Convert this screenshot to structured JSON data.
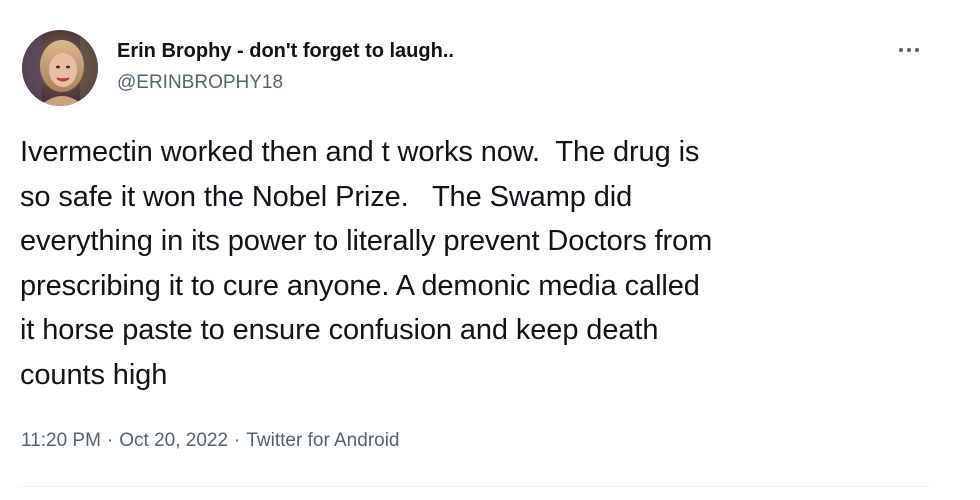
{
  "author": {
    "name": "Erin Brophy - don't forget to laugh..",
    "handle": "@ERINBROPHY18"
  },
  "tweet": {
    "lines": [
      "Ivermectin worked then and t works now.  The drug is",
      "so safe it won the Nobel Prize.   The Swamp did",
      "everything in its power to literally prevent Doctors from",
      "prescribing it to cure anyone. A demonic media called",
      "it horse paste to ensure confusion and keep death",
      "counts high"
    ]
  },
  "meta": {
    "time": "11:20 PM",
    "separator": "·",
    "date": "Oct 20, 2022",
    "source": "Twitter for Android"
  },
  "icons": {
    "more": "more-horizontal-icon"
  },
  "colors": {
    "text_primary": "#0f1419",
    "text_secondary": "#536471",
    "divider": "#eff3f4"
  }
}
